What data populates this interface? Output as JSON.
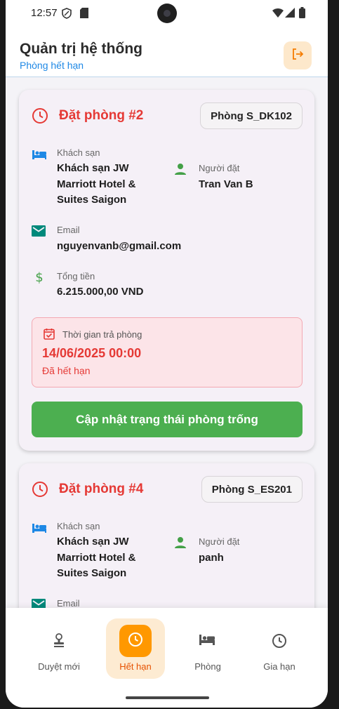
{
  "status_bar": {
    "time": "12:57"
  },
  "header": {
    "title": "Quản trị hệ thống",
    "subtitle": "Phòng hết hạn"
  },
  "bookings": [
    {
      "title": "Đặt phòng #2",
      "room": "Phòng S_DK102",
      "hotel_label": "Khách sạn",
      "hotel_lines": [
        "Khách sạn JW",
        "Marriott Hotel &",
        "Suites Saigon"
      ],
      "guest_label": "Người đặt",
      "guest": "Tran Van B",
      "email_label": "Email",
      "email": "nguyenvanb@gmail.com",
      "total_label": "Tổng tiền",
      "total": "6.215.000,00 VND",
      "checkout_label": "Thời gian trả phòng",
      "checkout": "14/06/2025 00:00",
      "status": "Đã hết hạn",
      "button": "Cập nhật trạng thái phòng trống"
    },
    {
      "title": "Đặt phòng #4",
      "room": "Phòng S_ES201",
      "hotel_label": "Khách sạn",
      "hotel_lines": [
        "Khách sạn JW",
        "Marriott Hotel &",
        "Suites Saigon"
      ],
      "guest_label": "Người đặt",
      "guest": "panh",
      "email_label": "Email"
    }
  ],
  "nav": [
    {
      "label": "Duyệt mới",
      "icon": "stamp-icon"
    },
    {
      "label": "Hết hạn",
      "icon": "clock-icon",
      "active": true
    },
    {
      "label": "Phòng",
      "icon": "bed-icon"
    },
    {
      "label": "Gia hạn",
      "icon": "clock-icon"
    }
  ],
  "colors": {
    "accent_red": "#e53935",
    "primary_blue": "#1e88e5",
    "success_green": "#4caf50",
    "active_orange": "#ff9800"
  }
}
